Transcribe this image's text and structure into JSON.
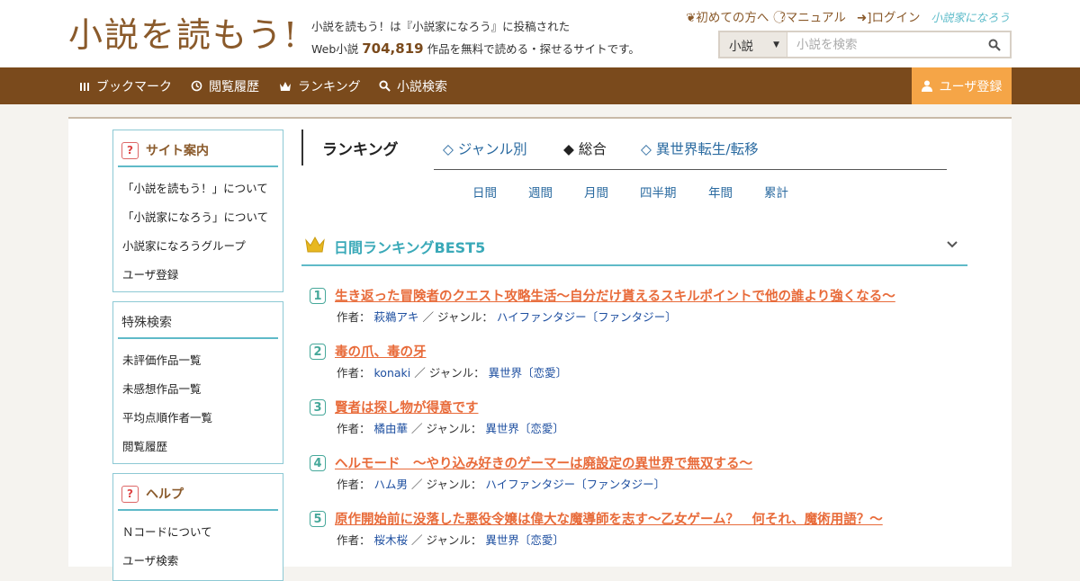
{
  "header": {
    "logo_text": "小説を読もう!",
    "tagline_line1": "小説を読もう！は『小説家になろう』に投稿された",
    "tagline_prefix": "Web小説",
    "work_count": "704,819",
    "tagline_suffix": "作品を無料で読める・探せるサイトです。",
    "links": {
      "first_time": "初めての方へ",
      "manual": "マニュアル",
      "login": "ログイン",
      "brand": "小説家になろう"
    },
    "search": {
      "category": "小説",
      "placeholder": "小説を検索"
    }
  },
  "nav": {
    "bookmark": "ブックマーク",
    "history": "閲覧履歴",
    "ranking": "ランキング",
    "search": "小説検索",
    "register": "ユーザ登録"
  },
  "sidebar": {
    "guide": {
      "title": "サイト案内",
      "items": [
        "「小説を読もう！」について",
        "「小説家になろう」について",
        "小説家になろうグループ",
        "ユーザ登録"
      ]
    },
    "special": {
      "title": "特殊検索",
      "items": [
        "未評価作品一覧",
        "未感想作品一覧",
        "平均点順作者一覧",
        "閲覧履歴"
      ]
    },
    "help": {
      "title": "ヘルプ",
      "items": [
        "Ｎコードについて",
        "ユーザ検索"
      ]
    }
  },
  "ranking": {
    "title": "ランキング",
    "tabs": [
      "◇ ジャンル別",
      "◆ 総合",
      "◇ 異世界転生/転移"
    ],
    "periods": [
      "日間",
      "週間",
      "月間",
      "四半期",
      "年間",
      "累計"
    ],
    "best_title": "日間ランキングBEST5",
    "author_label": "作者：",
    "genre_label": "／ ジャンル：",
    "entries": [
      {
        "rank": "1",
        "title": "生き返った冒険者のクエスト攻略生活～自分だけ貰えるスキルポイントで他の誰より強くなる～",
        "author": "萩鵜アキ",
        "genre": "ハイファンタジー〔ファンタジー〕"
      },
      {
        "rank": "2",
        "title": "毒の爪、毒の牙",
        "author": "konaki",
        "genre": "異世界〔恋愛〕"
      },
      {
        "rank": "3",
        "title": "賢者は探し物が得意です",
        "author": "橘由華",
        "genre": "異世界〔恋愛〕"
      },
      {
        "rank": "4",
        "title": "ヘルモード　～やり込み好きのゲーマーは廃設定の異世界で無双する～",
        "author": "ハム男",
        "genre": "ハイファンタジー〔ファンタジー〕"
      },
      {
        "rank": "5",
        "title": "原作開始前に没落した悪役令嬢は偉大な魔導師を志す～乙女ゲーム？　何それ、魔術用語？～",
        "author": "桜木桜",
        "genre": "異世界〔恋愛〕"
      }
    ]
  },
  "colors": {
    "brand_brown": "#7a4a1c",
    "register_orange": "#f5a547",
    "accent_teal": "#5fbac8",
    "title_orange": "#e86b3a",
    "link_blue": "#2a6aa0"
  }
}
